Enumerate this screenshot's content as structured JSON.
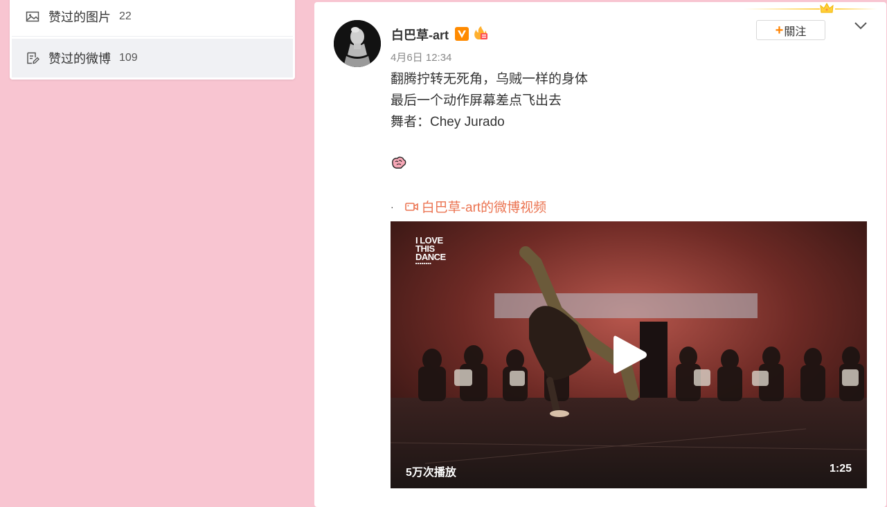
{
  "sidebar": {
    "items": [
      {
        "label": "赞过的图片",
        "count": "22",
        "icon": "image-icon"
      },
      {
        "label": "赞过的微博",
        "count": "109",
        "icon": "note-edit-icon",
        "active": true
      }
    ]
  },
  "post": {
    "user_name": "白巴草-art",
    "badges": [
      "verified-v-icon",
      "hot-badge-icon"
    ],
    "time": "4月6日 12:34",
    "follow_label": "關注",
    "lines": [
      "翻腾拧转无死角，乌贼一样的身体",
      "最后一个动作屏幕差点飞出去",
      "舞者：Chey Jurado"
    ],
    "bullet": "·",
    "video_link": "白巴草-art的微博视频",
    "video": {
      "logo_lines": [
        "I LOVE",
        "THIS",
        "DANCE"
      ],
      "views": "5万次播放",
      "duration": "1:25"
    }
  },
  "colors": {
    "page_bg": "#f8c5d1",
    "link": "#eb7350",
    "follow_plus": "#ff8200",
    "crown": "#ffd14a"
  }
}
